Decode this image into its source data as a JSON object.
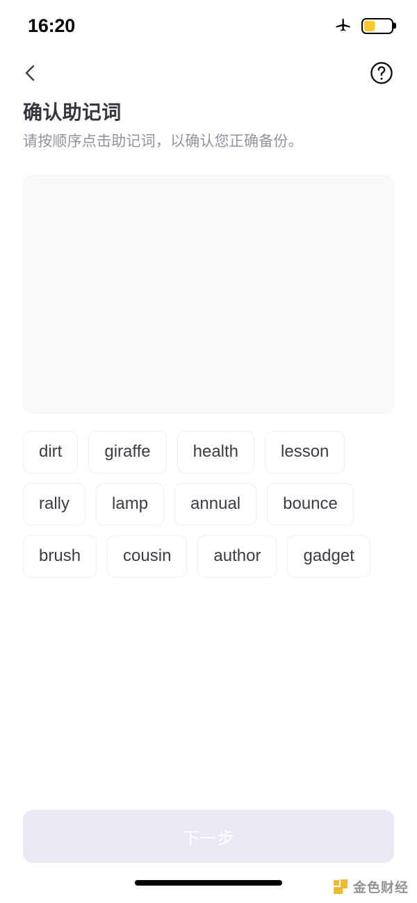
{
  "status_bar": {
    "time": "16:20",
    "airplane_icon": "airplane-mode-icon",
    "battery_icon": "battery-low-power-icon",
    "battery_level_percent": 40,
    "battery_color": "#fbc82e"
  },
  "nav": {
    "back_icon": "chevron-left-icon",
    "help_icon": "question-mark-circle-icon"
  },
  "heading": {
    "title": "确认助记词",
    "subtitle": "请按顺序点击助记词，以确认您正确备份。"
  },
  "answer_box": {
    "selected_words": [],
    "placeholder": ""
  },
  "word_pool": {
    "words": [
      "dirt",
      "giraffe",
      "health",
      "lesson",
      "rally",
      "lamp",
      "annual",
      "bounce",
      "brush",
      "cousin",
      "author",
      "gadget"
    ]
  },
  "footer": {
    "next_label": "下一步",
    "next_enabled": false,
    "next_bg_color": "#e9e9f6",
    "next_text_color": "#ffffff"
  },
  "watermark": {
    "text": "金色财经",
    "logo_color": "#f0b323"
  },
  "home_indicator": {
    "label": "home-indicator"
  }
}
